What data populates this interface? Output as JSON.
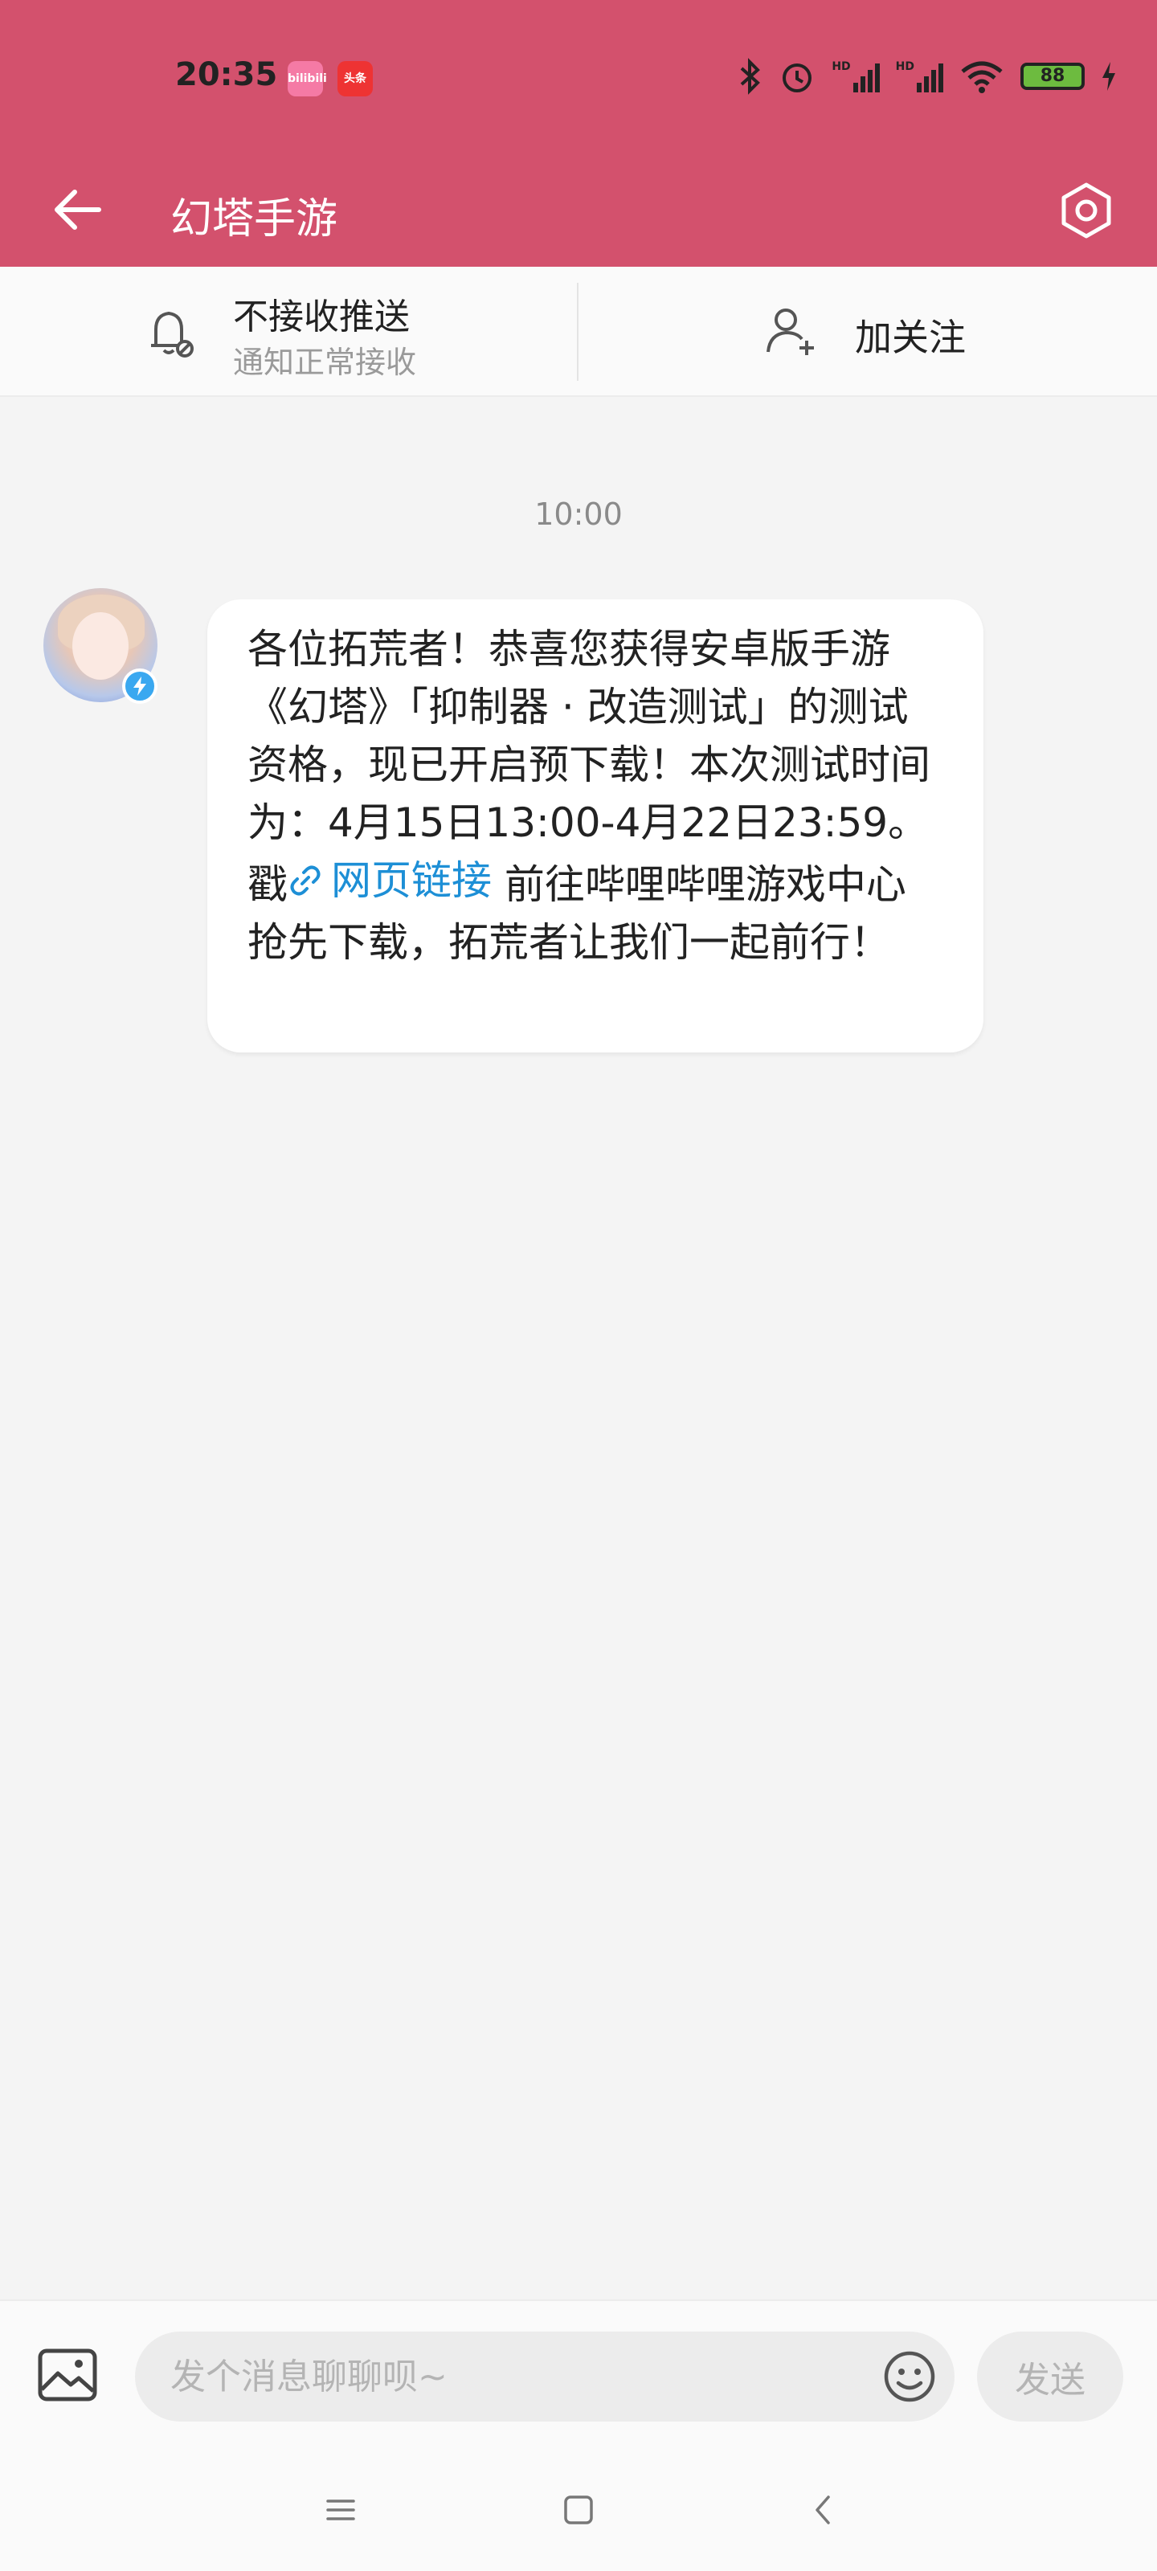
{
  "status_bar": {
    "time": "20:35",
    "app_badge_1": "bilibili",
    "app_badge_2": "头条",
    "battery": "88",
    "network_1": "HD",
    "network_2": "HD"
  },
  "header": {
    "title": "幻塔手游",
    "back_icon": "arrow-left-icon",
    "settings_icon": "hexagon-settings-icon"
  },
  "actions": {
    "push_title": "不接收推送",
    "push_subtitle": "通知正常接收",
    "follow_label": "加关注"
  },
  "chat": {
    "timestamp": "10:00",
    "message_before_link": "各位拓荒者！恭喜您获得安卓版手游《幻塔》「抑制器 · 改造测试」的测试资格，现已开启预下载！本次测试时间为：4月15日13:00-4月22日23:59。戳",
    "link_text": "网页链接",
    "message_after_link": " 前往哔哩哔哩游戏中心抢先下载，拓荒者让我们一起前行！"
  },
  "input_bar": {
    "placeholder": "发个消息聊聊呗~",
    "send_label": "发送"
  },
  "colors": {
    "header_bg": "#d3516d",
    "link": "#1d8fd6",
    "verify_badge": "#3aa8f0"
  }
}
